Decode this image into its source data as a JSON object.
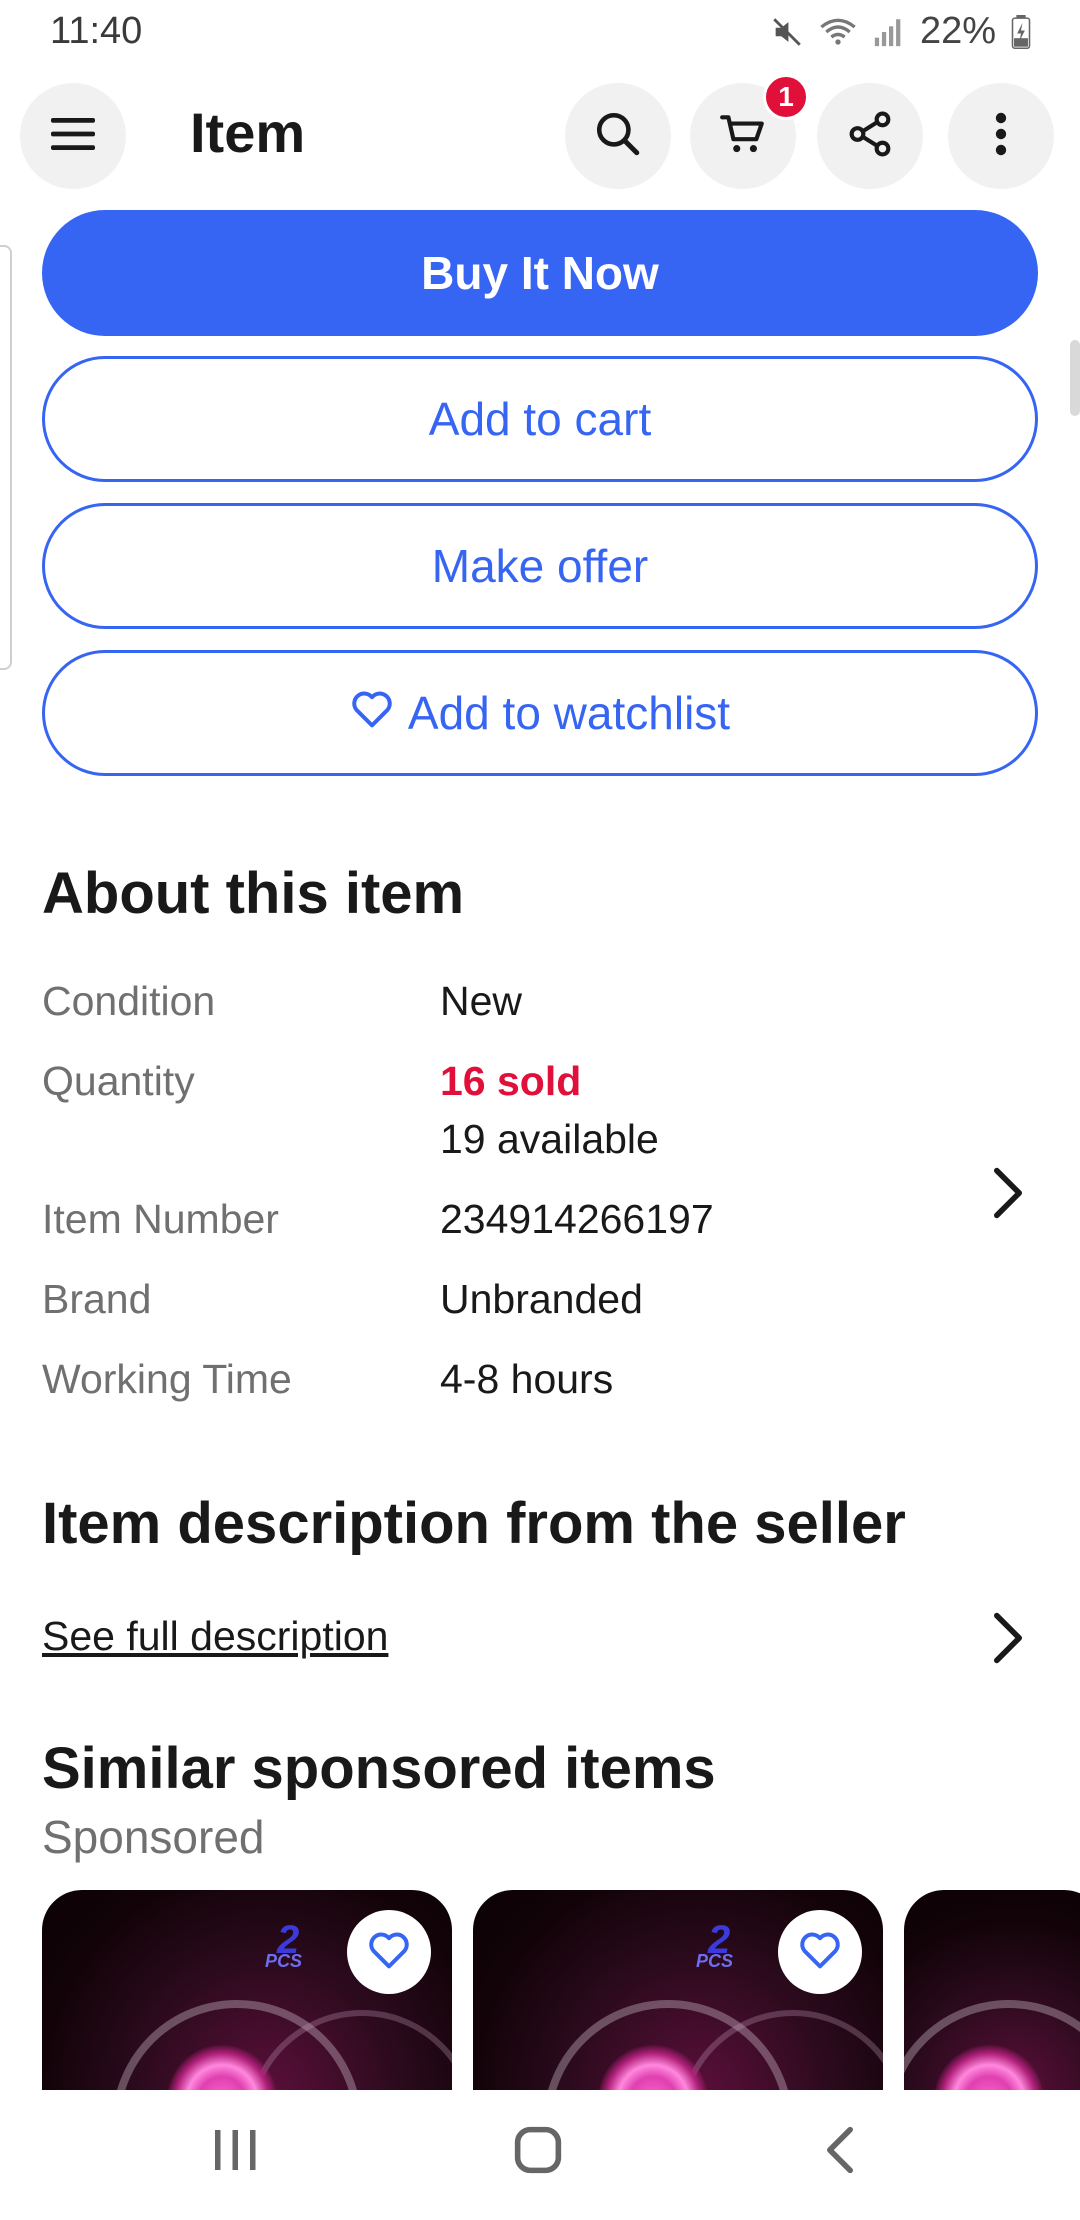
{
  "status_bar": {
    "time": "11:40",
    "battery": "22%"
  },
  "header": {
    "title": "Item",
    "cart_count": "1",
    "icons": [
      "menu-icon",
      "search-icon",
      "cart-icon",
      "share-icon",
      "more-vertical-icon"
    ]
  },
  "actions": {
    "buy_now": "Buy It Now",
    "add_to_cart": "Add to cart",
    "make_offer": "Make offer",
    "add_to_watchlist": "Add to watchlist"
  },
  "about": {
    "title": "About this item",
    "specs": [
      {
        "label": "Condition",
        "value": "New"
      },
      {
        "label": "Quantity",
        "sold": "16 sold",
        "value": "19 available"
      },
      {
        "label": "Item Number",
        "value": "234914266197"
      },
      {
        "label": "Brand",
        "value": "Unbranded"
      },
      {
        "label": "Working Time",
        "value": "4-8 hours"
      }
    ]
  },
  "description": {
    "title": "Item description from the seller",
    "link": "See full description"
  },
  "similar": {
    "title": "Similar sponsored items",
    "subtitle": "Sponsored",
    "cards": [
      {
        "badge": "2",
        "badge_sub": "PCS"
      },
      {
        "badge": "2",
        "badge_sub": "PCS"
      },
      {
        "badge": "",
        "badge_sub": ""
      }
    ]
  },
  "colors": {
    "accent": "#3665f3",
    "sold": "#e0103a",
    "badge": "#e0103a",
    "muted": "#707070"
  }
}
